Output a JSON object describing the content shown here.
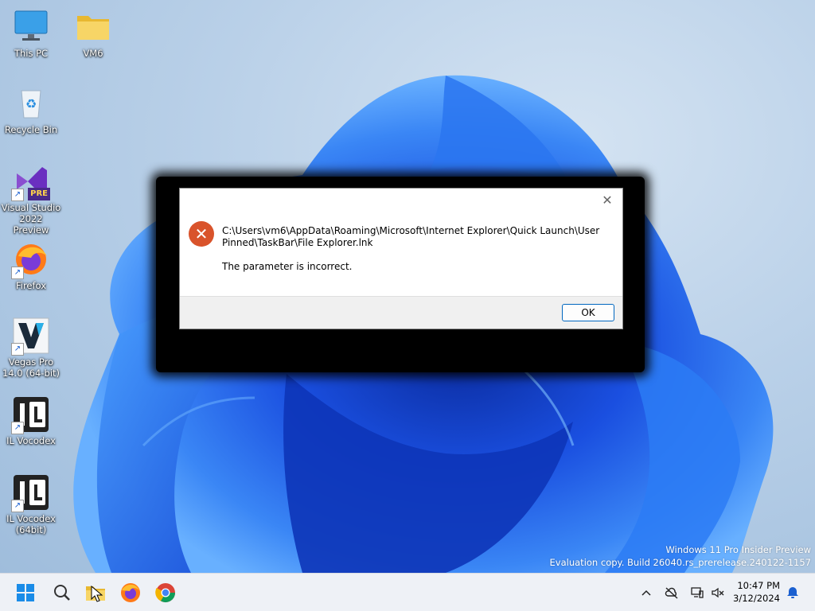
{
  "desktop": {
    "icons": [
      {
        "label": "This PC",
        "icon": "monitor-icon"
      },
      {
        "label": "VM6",
        "icon": "folder-icon"
      },
      {
        "label": "Recycle Bin",
        "icon": "recycle-bin-icon"
      },
      {
        "label": "Visual Studio 2022 Preview",
        "icon": "visual-studio-icon",
        "badge": "PRE"
      },
      {
        "label": "Firefox",
        "icon": "firefox-icon"
      },
      {
        "label": "Vegas Pro 14.0 (64-bit)",
        "icon": "vegas-pro-icon"
      },
      {
        "label": "IL Vocodex",
        "icon": "il-vocodex-icon"
      },
      {
        "label": "IL Vocodex (64bit)",
        "icon": "il-vocodex-icon"
      }
    ],
    "watermark": {
      "line1": "Windows 11 Pro Insider Preview",
      "line2": "Evaluation copy. Build 26040.rs_prerelease.240122-1157"
    }
  },
  "dialog": {
    "close_glyph": "✕",
    "error_glyph": "✕",
    "path": "C:\\Users\\vm6\\AppData\\Roaming\\Microsoft\\Internet Explorer\\Quick Launch\\User Pinned\\TaskBar\\File Explorer.lnk",
    "message": "The parameter is incorrect.",
    "ok_label": "OK"
  },
  "taskbar": {
    "items": [
      "start-icon",
      "search-icon",
      "file-explorer-icon",
      "firefox-icon",
      "chrome-icon"
    ],
    "tray": {
      "chevron": "^",
      "time": "10:47 PM",
      "date": "3/12/2024"
    }
  },
  "colors": {
    "error_red": "#d9532b",
    "accent_blue": "#0067c0",
    "taskbar_bg": "#eef1f6"
  }
}
